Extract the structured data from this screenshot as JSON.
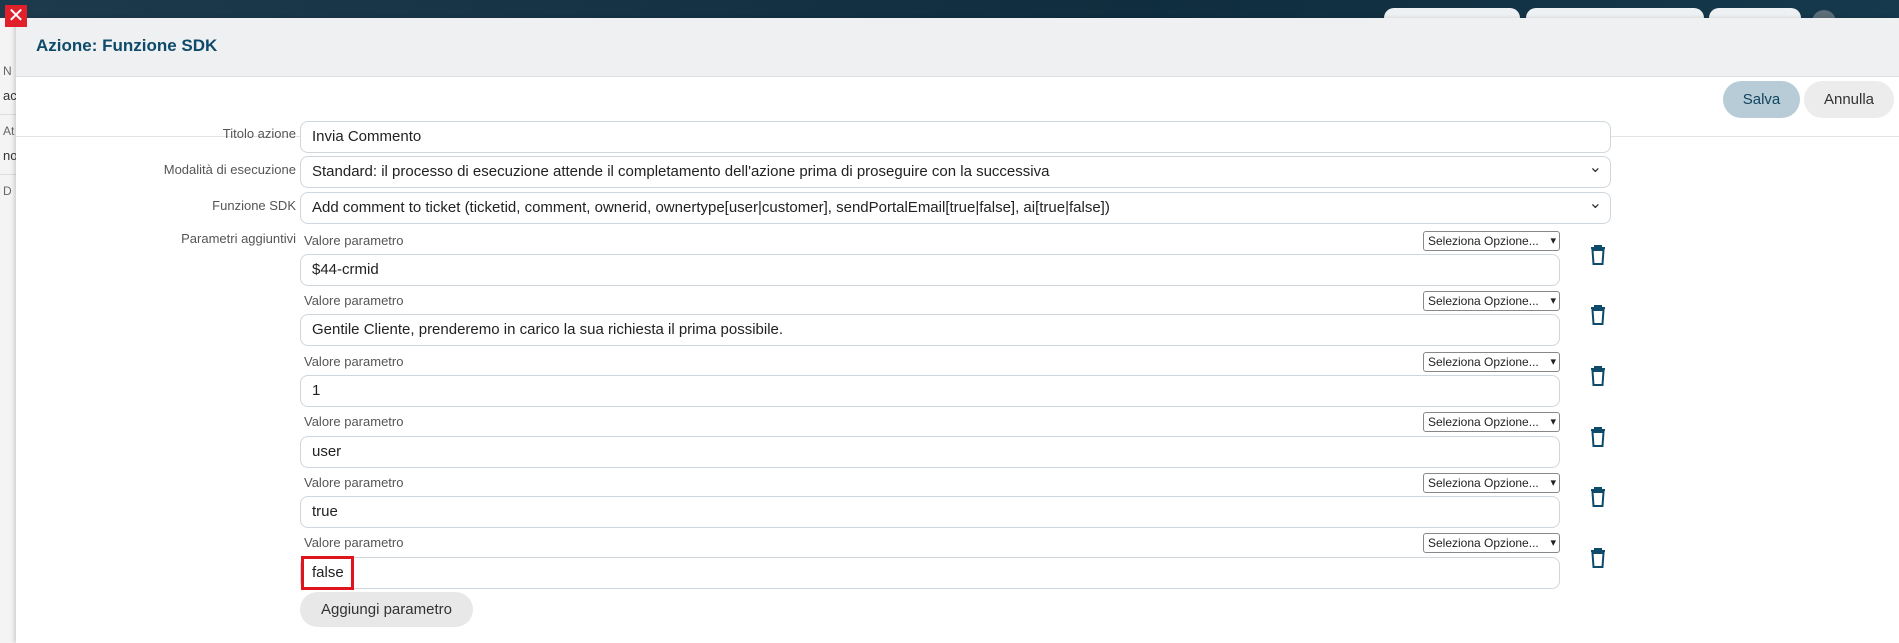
{
  "modal": {
    "title": "Azione: Funzione SDK",
    "save_label": "Salva",
    "cancel_label": "Annulla"
  },
  "background": {
    "left_texts": [
      "N",
      "ac",
      "At",
      "no",
      "D"
    ]
  },
  "form": {
    "titolo_label": "Titolo azione",
    "titolo_value": "Invia Commento",
    "modalita_label": "Modalità di esecuzione",
    "modalita_value": "Standard: il processo di esecuzione attende il completamento dell'azione prima di proseguire con la successiva",
    "funzione_label": "Funzione SDK",
    "funzione_value": "Add comment to ticket (ticketid, comment, ownerid, ownertype[user|customer], sendPortalEmail[true|false], ai[true|false])",
    "parametri_label": "Parametri aggiuntivi",
    "params": [
      {
        "label": "Valore parametro",
        "select": "Seleziona Opzione...",
        "value": "$44-crmid"
      },
      {
        "label": "Valore parametro",
        "select": "Seleziona Opzione...",
        "value": "Gentile Cliente, prenderemo in carico la sua richiesta il prima possibile."
      },
      {
        "label": "Valore parametro",
        "select": "Seleziona Opzione...",
        "value": "1"
      },
      {
        "label": "Valore parametro",
        "select": "Seleziona Opzione...",
        "value": "user"
      },
      {
        "label": "Valore parametro",
        "select": "Seleziona Opzione...",
        "value": "true"
      },
      {
        "label": "Valore parametro",
        "select": "Seleziona Opzione...",
        "value": "false"
      }
    ],
    "add_param_label": "Aggiungi parametro"
  },
  "icons": {
    "close": "close-icon",
    "delete": "trash-icon"
  },
  "colors": {
    "accent": "#0e4a6a",
    "save_button": "#b7ccd7",
    "highlight": "#e0141c",
    "close": "#e0202a"
  }
}
